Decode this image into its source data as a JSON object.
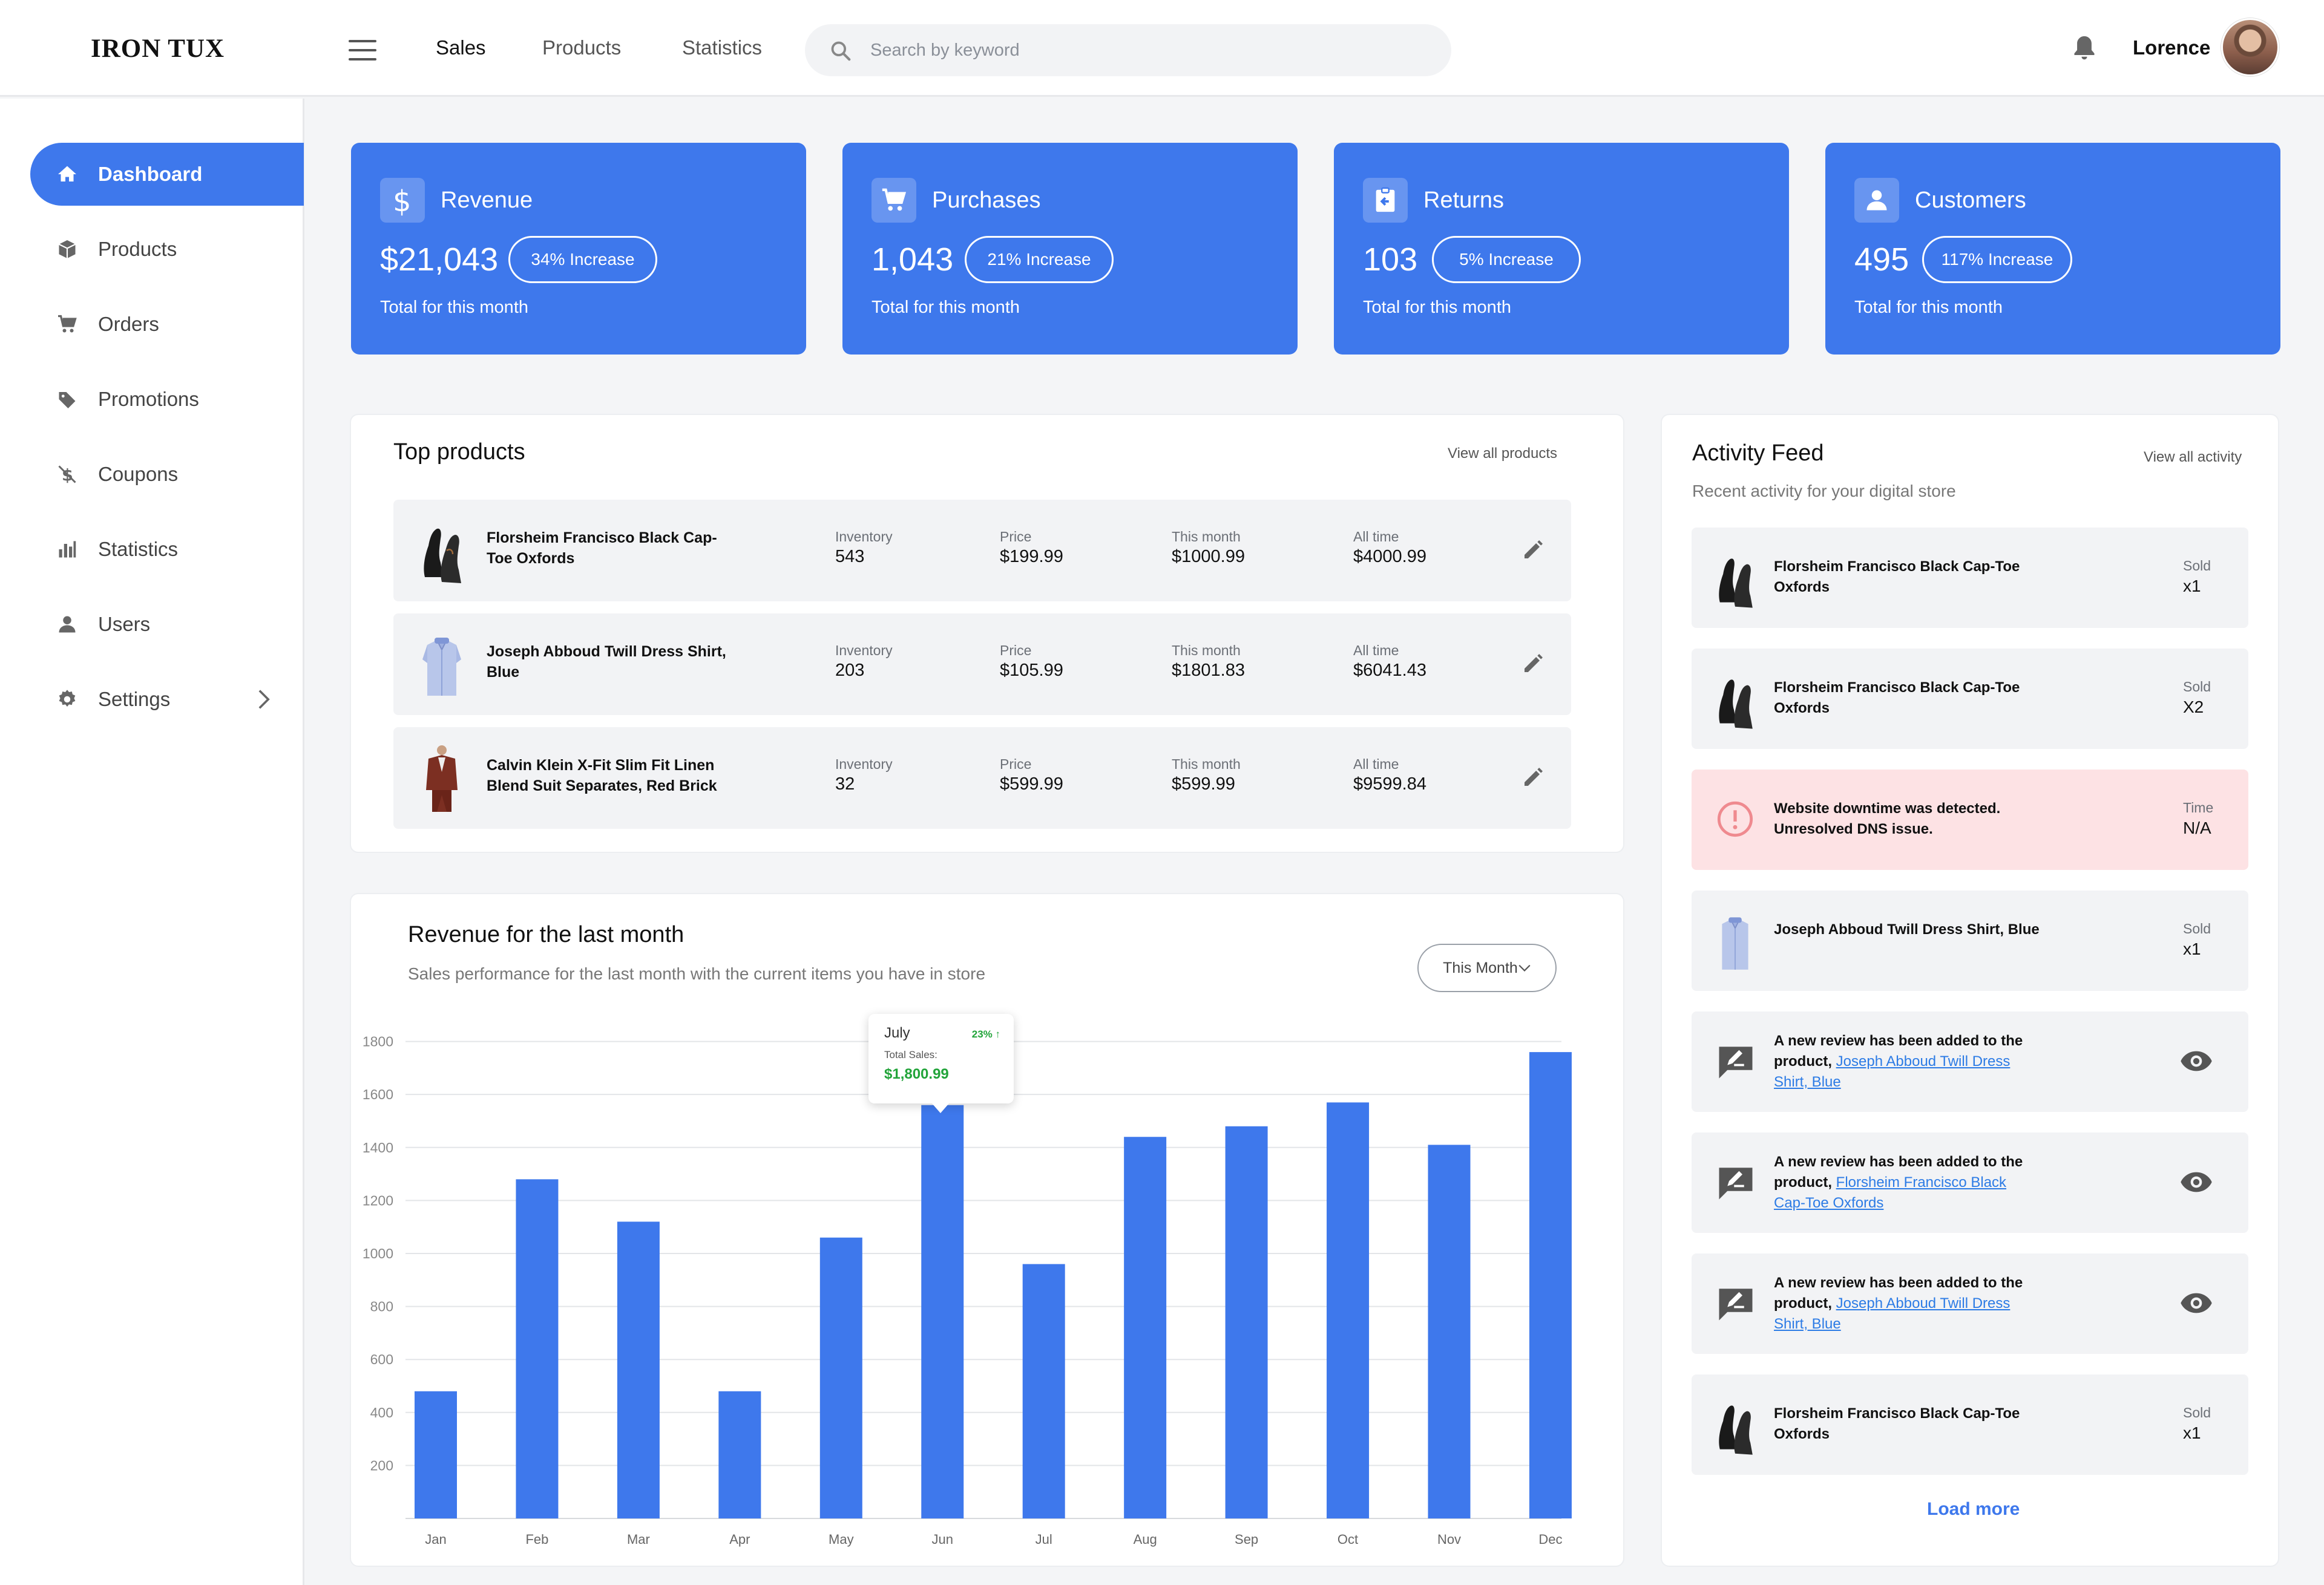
{
  "brand": "IRON TUX",
  "topnav": [
    "Sales",
    "Products",
    "Statistics"
  ],
  "search": {
    "placeholder": "Search by keyword"
  },
  "user": {
    "name": "Lorence"
  },
  "sidebar": {
    "items": [
      {
        "label": "Dashboard",
        "icon": "home-icon"
      },
      {
        "label": "Products",
        "icon": "box-icon"
      },
      {
        "label": "Orders",
        "icon": "cart-icon"
      },
      {
        "label": "Promotions",
        "icon": "tag-icon"
      },
      {
        "label": "Coupons",
        "icon": "coupon-icon"
      },
      {
        "label": "Statistics",
        "icon": "bar-chart-icon"
      },
      {
        "label": "Users",
        "icon": "user-icon"
      },
      {
        "label": "Settings",
        "icon": "gear-icon"
      }
    ]
  },
  "stats": [
    {
      "title": "Revenue",
      "value": "$21,043",
      "pill": "34% Increase",
      "foot": "Total for this month",
      "icon": "dollar-icon"
    },
    {
      "title": "Purchases",
      "value": "1,043",
      "pill": "21% Increase",
      "foot": "Total for this month",
      "icon": "cart-icon"
    },
    {
      "title": "Returns",
      "value": "103",
      "pill": "5% Increase",
      "foot": "Total for this month",
      "icon": "return-icon"
    },
    {
      "title": "Customers",
      "value": "495",
      "pill": "117% Increase",
      "foot": "Total for this month",
      "icon": "user-icon"
    }
  ],
  "top_products": {
    "title": "Top products",
    "link": "View all products",
    "labels": {
      "inventory": "Inventory",
      "price": "Price",
      "month": "This month",
      "all": "All time"
    },
    "rows": [
      {
        "name": "Florsheim Francisco Black Cap-Toe Oxfords",
        "inventory": "543",
        "price": "$199.99",
        "month": "$1000.99",
        "all": "$4000.99",
        "image": "shoe"
      },
      {
        "name": "Joseph Abboud Twill Dress Shirt, Blue",
        "inventory": "203",
        "price": "$105.99",
        "month": "$1801.83",
        "all": "$6041.43",
        "image": "shirt"
      },
      {
        "name": "Calvin Klein X-Fit Slim Fit Linen Blend Suit Separates, Red Brick",
        "inventory": "32",
        "price": "$599.99",
        "month": "$599.99",
        "all": "$9599.84",
        "image": "suit"
      }
    ]
  },
  "revenue": {
    "title": "Revenue for the last month",
    "subtitle": "Sales performance for the last month with the current items you have in store",
    "dropdown": "This Month",
    "tooltip": {
      "month": "July",
      "pct": "23%",
      "label": "Total Sales:",
      "value": "$1,800.99"
    }
  },
  "chart_data": {
    "type": "bar",
    "categories": [
      "Jan",
      "Feb",
      "Mar",
      "Apr",
      "May",
      "Jun",
      "Jul",
      "Aug",
      "Sep",
      "Oct",
      "Nov",
      "Dec"
    ],
    "values": [
      480,
      1280,
      1120,
      480,
      1060,
      1560,
      960,
      1440,
      1480,
      1570,
      1410,
      1760
    ],
    "yticks": [
      200,
      400,
      600,
      800,
      1000,
      1200,
      1400,
      1600,
      1800
    ],
    "ylim": [
      0,
      1800
    ],
    "color": "#3e78ec"
  },
  "activity": {
    "title": "Activity Feed",
    "link": "View all activity",
    "subtitle": "Recent activity for your digital store",
    "items": [
      {
        "type": "sold",
        "image": "shoe",
        "text": "Florsheim Francisco Black Cap-Toe Oxfords",
        "label": "Sold",
        "value": "x1"
      },
      {
        "type": "sold",
        "image": "shoe",
        "text": "Florsheim Francisco Black Cap-Toe Oxfords",
        "label": "Sold",
        "value": "X2"
      },
      {
        "type": "alert",
        "text": "Website downtime was detected. Unresolved DNS issue.",
        "label": "Time",
        "value": "N/A"
      },
      {
        "type": "sold",
        "image": "shirt",
        "text": "Joseph Abboud Twill Dress Shirt, Blue",
        "label": "Sold",
        "value": "x1"
      },
      {
        "type": "review",
        "prefix": "A new review has been added to the product, ",
        "link": "Joseph Abboud Twill Dress Shirt, Blue"
      },
      {
        "type": "review",
        "prefix": "A new review has been added to the product, ",
        "link": "Florsheim Francisco Black Cap-Toe Oxfords"
      },
      {
        "type": "review",
        "prefix": "A new review has been added to the product, ",
        "link": "Joseph Abboud Twill Dress Shirt, Blue"
      },
      {
        "type": "sold",
        "image": "shoe",
        "text": "Florsheim Francisco Black Cap-Toe Oxfords",
        "label": "Sold",
        "value": "x1"
      }
    ],
    "load_more": "Load more"
  }
}
